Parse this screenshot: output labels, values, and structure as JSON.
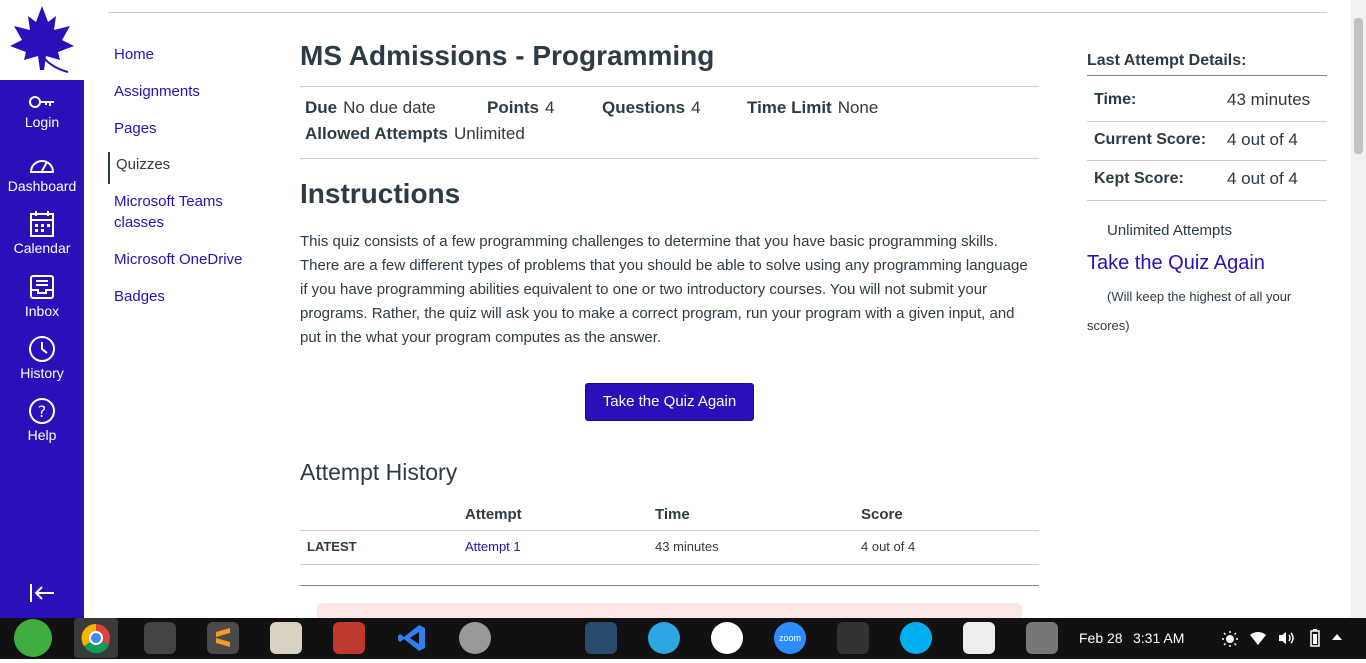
{
  "global_nav": {
    "items": [
      {
        "label": "Login",
        "icon": "key-icon"
      },
      {
        "label": "Dashboard",
        "icon": "dashboard-icon"
      },
      {
        "label": "Calendar",
        "icon": "calendar-icon"
      },
      {
        "label": "Inbox",
        "icon": "inbox-icon"
      },
      {
        "label": "History",
        "icon": "clock-icon"
      },
      {
        "label": "Help",
        "icon": "help-icon"
      }
    ]
  },
  "course_nav": {
    "items": [
      "Home",
      "Assignments",
      "Pages",
      "Quizzes",
      "Microsoft Teams classes",
      "Microsoft OneDrive",
      "Badges"
    ],
    "active": "Quizzes"
  },
  "quiz": {
    "title": "MS Admissions - Programming",
    "due_label": "Due",
    "due_value": "No due date",
    "points_label": "Points",
    "points_value": "4",
    "questions_label": "Questions",
    "questions_value": "4",
    "time_limit_label": "Time Limit",
    "time_limit_value": "None",
    "attempts_label": "Allowed Attempts",
    "attempts_value": "Unlimited",
    "instructions_heading": "Instructions",
    "instructions": "This quiz consists of a few programming challenges to determine that you have basic programming skills. There are a few different types of problems that you should be able to solve using any programming language if you have programming abilities equivalent to one or two introductory courses. You will not submit your programs. Rather, the quiz will ask you to make a correct program, run your program with a given input, and put in the what your program computes as the answer.",
    "take_again_button": "Take the Quiz Again"
  },
  "history": {
    "title": "Attempt History",
    "headers": [
      "Attempt",
      "Time",
      "Score"
    ],
    "rows": [
      {
        "label": "LATEST",
        "attempt": "Attempt 1",
        "time": "43 minutes",
        "score": "4 out of 4"
      }
    ]
  },
  "sidebar": {
    "title": "Last Attempt Details:",
    "time_label": "Time:",
    "time_value": "43 minutes",
    "current_label": "Current Score:",
    "current_value": "4 out of 4",
    "kept_label": "Kept Score:",
    "kept_value": "4 out of 4",
    "unlimited": "Unlimited Attempts",
    "take_again_link": "Take the Quiz Again",
    "note": "(Will keep the highest of all your scores)"
  },
  "taskbar": {
    "date": "Feb 28",
    "time": "3:31 AM",
    "zoom_label": "zoom"
  },
  "colors": {
    "brand": "#2c0fb8"
  }
}
